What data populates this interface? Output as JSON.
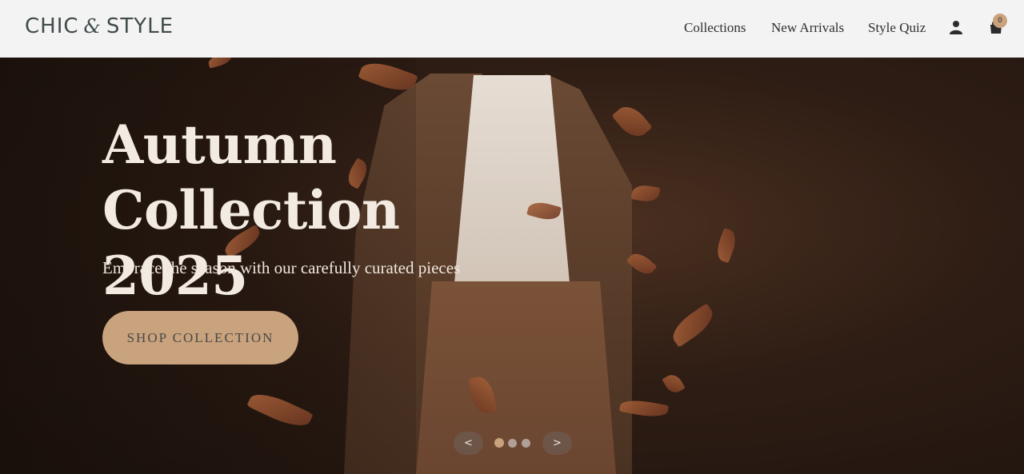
{
  "header": {
    "logo_left": "CHIC",
    "logo_amp": "&",
    "logo_right": "STYLE",
    "nav": [
      "Collections",
      "New Arrivals",
      "Style Quiz"
    ],
    "cart_count": "0"
  },
  "hero": {
    "title_line1": "Autumn",
    "title_line2": "Collection 2025",
    "subtitle": "Embrace the season with our carefully curated pieces",
    "cta_label": "SHOP COLLECTION"
  },
  "carousel": {
    "prev_label": "<",
    "next_label": ">",
    "slide_count": 3,
    "active_slide": 1
  },
  "colors": {
    "accent": "#c9a27e",
    "header_bg": "#f4f3f3",
    "hero_text": "#f3ebe1"
  },
  "icons": {
    "user": "user-icon",
    "cart": "cart-icon"
  }
}
